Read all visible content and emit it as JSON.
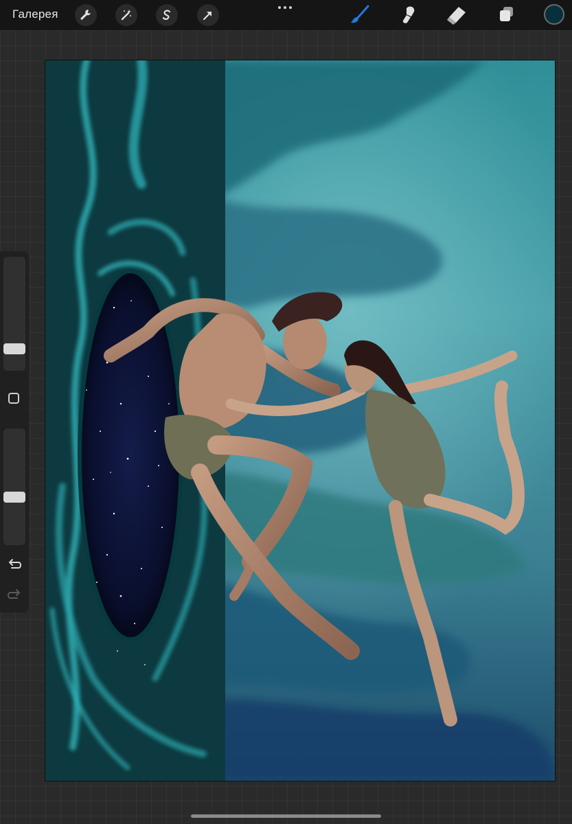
{
  "app": {
    "gallery_label": "Галерея"
  },
  "toolbar": {
    "actions": [
      "wrench-icon",
      "magic-wand-icon",
      "selection-s-icon",
      "transform-arrow-icon"
    ],
    "more_icon": "three-dots-icon",
    "tools": [
      "brush-icon",
      "smudge-icon",
      "eraser-icon",
      "layers-icon"
    ],
    "active_tool": "brush",
    "active_tool_color": "#1f7ae0",
    "current_color": "#08303c"
  },
  "sidebar": {
    "brush_size_level": 0.2,
    "opacity_level": 0.2,
    "modify_icon": "square-icon",
    "undo_icon": "undo-arrow-icon",
    "redo_icon": "redo-arrow-icon"
  },
  "canvas": {
    "artwork": "painting-two-dancers-portal"
  }
}
